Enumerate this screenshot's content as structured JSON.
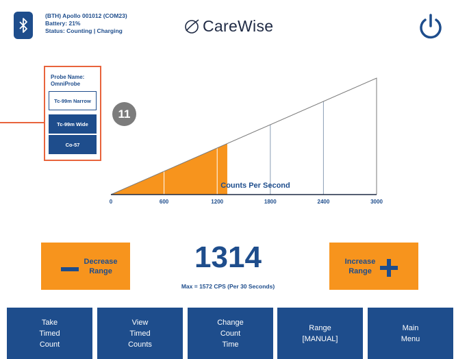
{
  "header": {
    "device_line": "(BTH) Apollo 001012 (COM23)",
    "battery_line": "Battery: 21%",
    "status_line": "Status: Counting | Charging",
    "logo_text": "CareWise"
  },
  "probe_panel": {
    "title": "Probe Name:\nOmniProbe",
    "options": [
      "Tc-99m Narrow",
      "Tc-99m Wide",
      "Co-57"
    ],
    "selected": "Tc-99m Narrow"
  },
  "callout_badge": "11",
  "meter": {
    "label": "Counts Per Second",
    "ticks": [
      "0",
      "600",
      "1200",
      "1800",
      "2400",
      "3000"
    ],
    "max": 3000,
    "fill_value": 1314,
    "fill_color": "#f7941d"
  },
  "controls": {
    "decrease_label": "Decrease\nRange",
    "increase_label": "Increase\nRange",
    "count_value": "1314",
    "max_text": "Max = 1572 CPS (Per 30 Seconds)"
  },
  "menu": [
    "Take\nTimed\nCount",
    "View\nTimed\nCounts",
    "Change\nCount\nTime",
    "Range\n[MANUAL]",
    "Main\nMenu"
  ],
  "colors": {
    "primary": "#1e4d8c",
    "accent": "#f7941d",
    "callout": "#e8643c",
    "badge": "#7c7c7c"
  }
}
